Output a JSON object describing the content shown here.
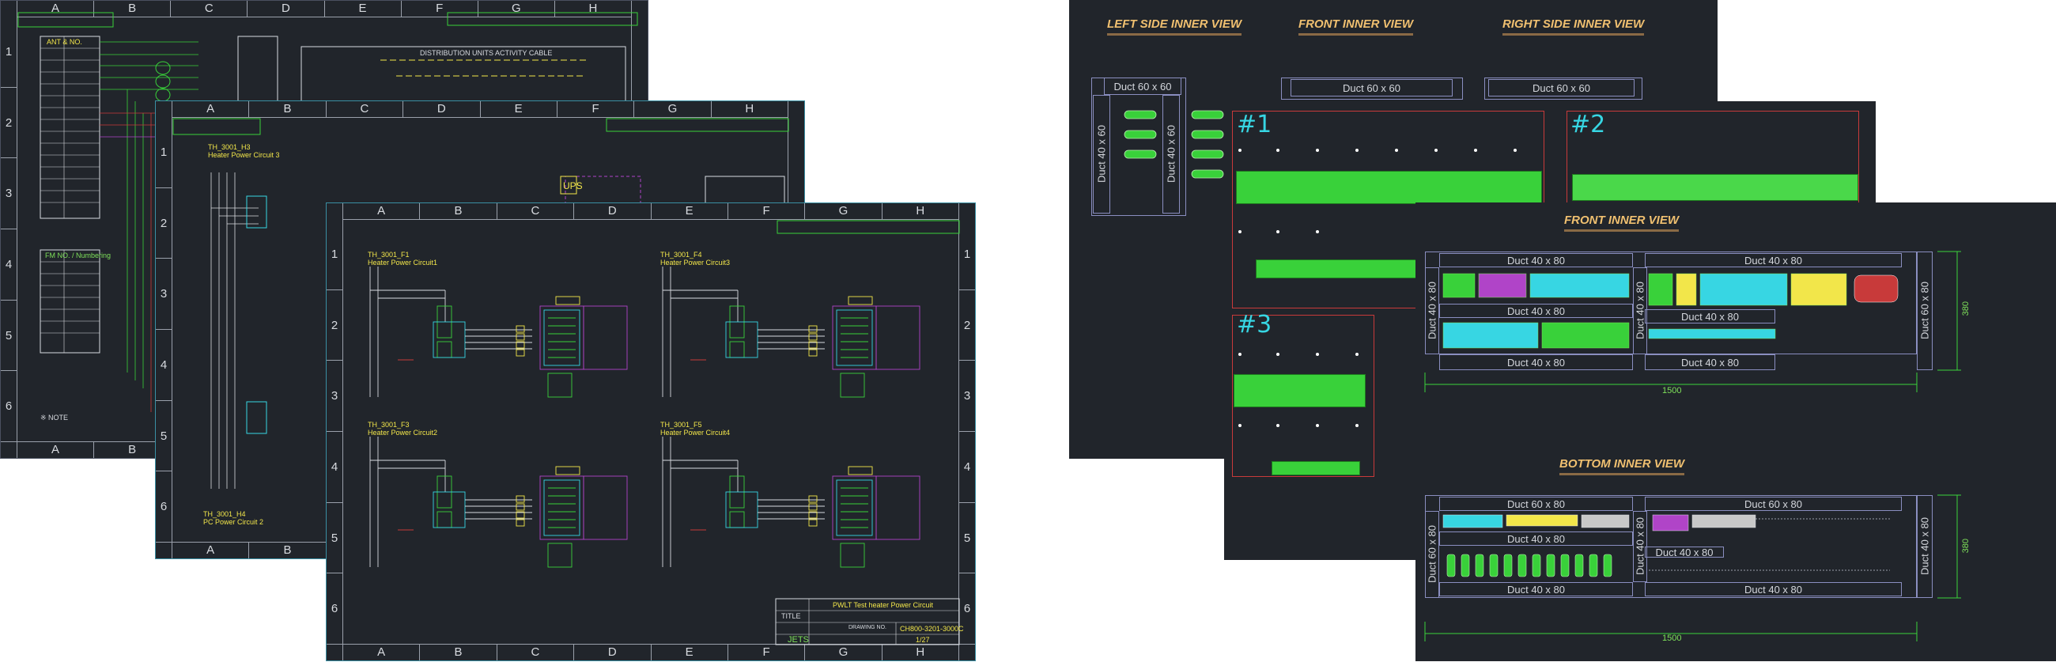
{
  "columns_8": [
    "A",
    "B",
    "C",
    "D",
    "E",
    "F",
    "G",
    "H"
  ],
  "rows_6": [
    "1",
    "2",
    "3",
    "4",
    "5",
    "6"
  ],
  "sheet1": {
    "header_block_a": "ANT & NO.",
    "header_block_b": "FM NO. / Numbering",
    "note_title": "※ NOTE",
    "dist_title": "DISTRIBUTION UNITS ACTIVITY CABLE",
    "ups": "UPS"
  },
  "sheet3": {
    "circuits": [
      {
        "id": "TH_3001_F1",
        "title": "Heater Power Circuit1"
      },
      {
        "id": "TH_3001_F4",
        "title": "Heater Power Circuit3"
      },
      {
        "id": "TH_3001_F3",
        "title": "Heater Power Circuit2"
      },
      {
        "id": "TH_3001_F5",
        "title": "Heater Power Circuit4"
      }
    ],
    "sheet2_circuit": {
      "id": "TH_3001_H3",
      "title": "Heater Power Circuit 3"
    },
    "sheet2_bottom": {
      "id": "TH_3001_H4",
      "title": "PC Power Circuit 2"
    },
    "titleblock": {
      "title_label": "TITLE",
      "title": "PWLT Test heater Power Circuit",
      "dwg_label": "DRAWING NO.",
      "dwg_no": "CH800-3201-3000C",
      "logo": "JETS",
      "sheet": "1/27"
    }
  },
  "right": {
    "left_side": "LEFT SIDE INNER VIEW",
    "front": "FRONT INNER VIEW",
    "right_side": "RIGHT SIDE INNER VIEW",
    "front2": "FRONT INNER VIEW",
    "bottom": "BOTTOM INNER VIEW",
    "duct_60x60": "Duct 60 x 60",
    "duct_40x60": "Duct 40 x 60",
    "duct_40x80": "Duct 40 x 80",
    "duct_60x80": "Duct 60 x 80",
    "num1": "#1",
    "num2": "#2",
    "num3": "#3",
    "dim_1500": "1500",
    "dim_380": "380"
  },
  "colors": {
    "bg": "#21252b",
    "green": "#39d13a",
    "cyan": "#37d6e3",
    "yellow": "#f2e64a",
    "magenta": "#b044c8",
    "red": "#c83a3a"
  }
}
